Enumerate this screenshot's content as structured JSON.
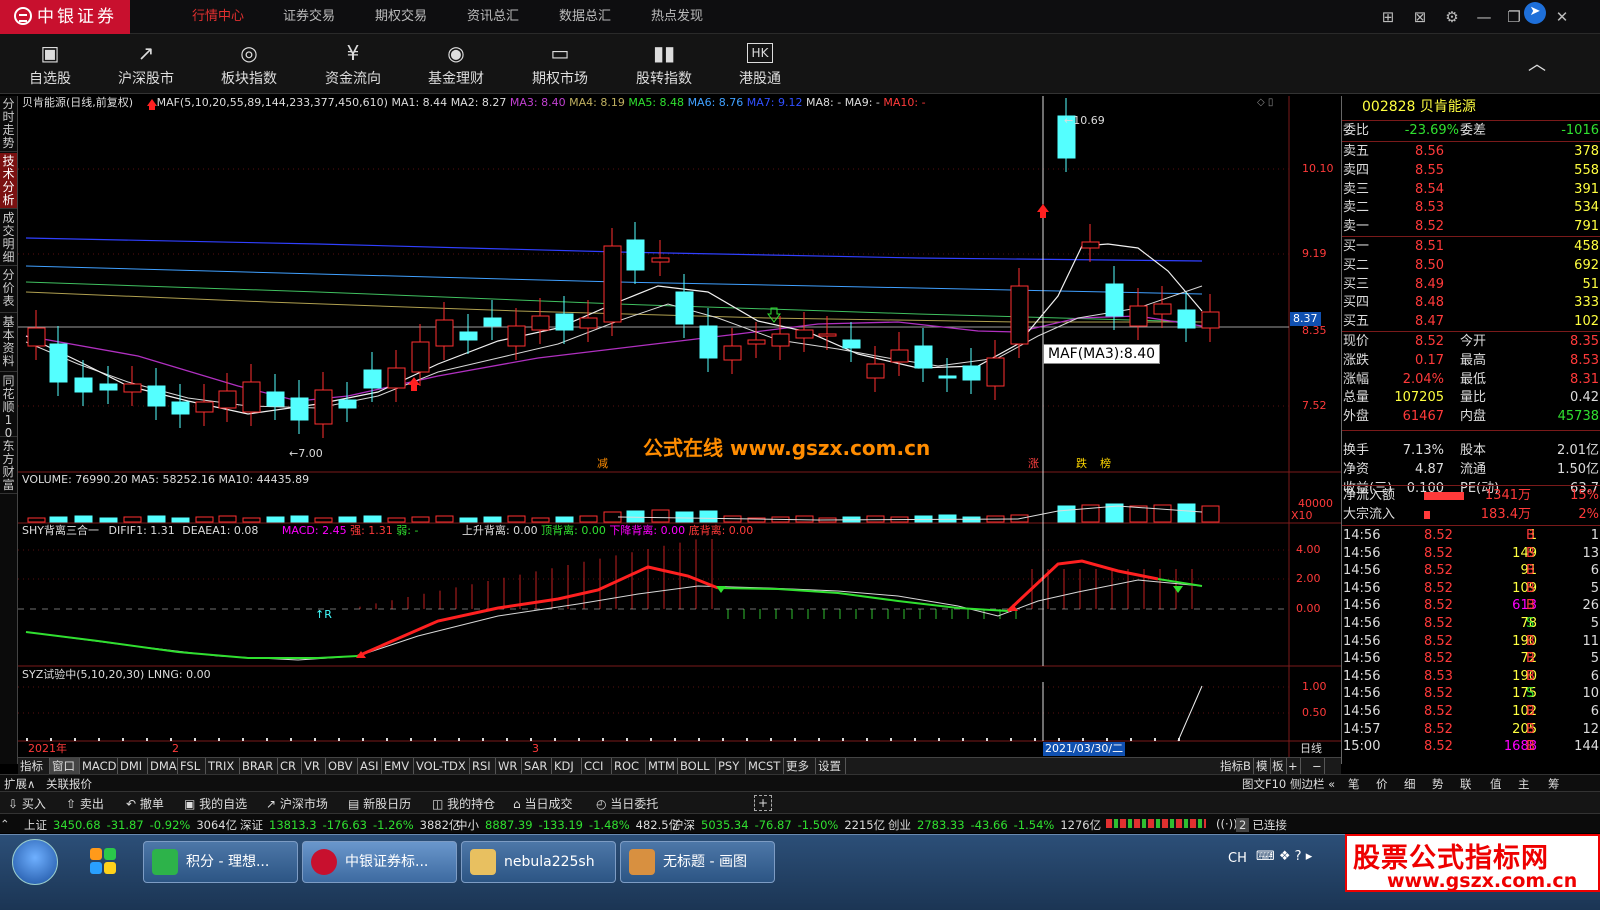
{
  "brand": "中银证券",
  "nav": {
    "menus": [
      "行情中心",
      "证券交易",
      "期权交易",
      "资讯总汇",
      "数据总汇",
      "热点发现"
    ]
  },
  "toolbar": [
    "自选股",
    "沪深股市",
    "板块指数",
    "资金流向",
    "基金理财",
    "期权市场",
    "股转指数",
    "港股通"
  ],
  "toolbar_icons": [
    "folder-heart-icon",
    "chart-trend-icon",
    "sector-icon",
    "money-flow-icon",
    "fund-icon",
    "option-icon",
    "bar-index-icon",
    "hk-icon"
  ],
  "leftbar": [
    "分时走势",
    "技术分析",
    "成交明细",
    "分价表",
    "基本资料",
    "同花顺10",
    "东方财富"
  ],
  "main_header": {
    "title": "贝肯能源(日线,前复权)",
    "maf": "MAF(5,10,20,55,89,144,233,377,450,610)",
    "ma1": "MA1: 8.44",
    "ma2": "MA2: 8.27",
    "ma3": "MA3: 8.40",
    "ma4": "MA4: 8.19",
    "ma5": "MA5: 8.48",
    "ma6": "MA6: 8.76",
    "ma7": "MA7: 9.12",
    "ma8": "MA8: -",
    "ma9": "MA9: -",
    "ma10": "MA10: -"
  },
  "price_axis": [
    "10.10",
    "9.19",
    "8.35",
    "7.52"
  ],
  "price_tag": "8.37",
  "hi_label": "10.69",
  "lo_label": "7.00",
  "tooltip": "MAF(MA3):8.40",
  "watermark": "公式在线 www.gszx.com.cn",
  "marks": {
    "jian": "减",
    "zhang": "涨",
    "die": "跌",
    "bei": "榜"
  },
  "volume_header": "VOLUME: 76990.20  MA5: 58252.16  MA10: 44435.89",
  "vol_axis": "40000",
  "vol_unit": "X10",
  "macd_header": {
    "name": "SHY背离三合一",
    "dif": "DIFIF1: 1.31",
    "dea": "DEAEA1: 0.08",
    "macd": "MACD: 2.45",
    "qiang": "强: 1.31",
    "ruo": "弱: -",
    "up": "上升背离: 0.00",
    "top": "顶背离: 0.00",
    "down": "下降背离: 0.00",
    "bottom": "底背离: 0.00"
  },
  "macd_axis": [
    "4.00",
    "2.00",
    "0.00"
  ],
  "macd_mark": "↑R",
  "syz_header": "SYZ试验中(5,10,20,30)  LNNG: 0.00",
  "syz_axis": [
    "1.00",
    "0.50"
  ],
  "dates": {
    "d0": "2021年",
    "d1": "2",
    "d2": "3",
    "cur": "2021/03/30/二",
    "period": "日线"
  },
  "index_tabs": [
    "指标A",
    "窗口",
    "MACD",
    "DMI",
    "DMA",
    "FSL",
    "TRIX",
    "BRAR",
    "CR",
    "VR",
    "OBV",
    "ASI",
    "EMV",
    "VOL-TDX",
    "RSI",
    "WR",
    "SAR",
    "KDJ",
    "CCI",
    "ROC",
    "MTM",
    "BOLL",
    "PSY",
    "MCST",
    "更多",
    "设置"
  ],
  "index_right": [
    "指标B",
    "模",
    "板",
    "+",
    "−"
  ],
  "status1": {
    "left1": "扩展∧",
    "left2": "关联报价",
    "right": [
      "图文F10",
      "侧边栏 «",
      "笔",
      "价",
      "细",
      "势",
      "联",
      "值",
      "主",
      "筹"
    ]
  },
  "actions": [
    "买入",
    "卖出",
    "撤单",
    "我的自选",
    "沪深市场",
    "新股日历",
    "我的持仓",
    "当日成交",
    "当日委托"
  ],
  "markets": [
    {
      "name": "上证",
      "val": "3450.68",
      "chg": "-31.87",
      "pct": "-0.92%",
      "amt": "3064亿"
    },
    {
      "name": "深证",
      "val": "13813.3",
      "chg": "-176.63",
      "pct": "-1.26%",
      "amt": "3882亿"
    },
    {
      "name": "中小",
      "val": "8887.39",
      "chg": "-133.19",
      "pct": "-1.48%",
      "amt": "482.5亿"
    },
    {
      "name": "沪深",
      "val": "5035.34",
      "chg": "-76.87",
      "pct": "-1.50%",
      "amt": "2215亿"
    },
    {
      "name": "创业",
      "val": "2783.33",
      "chg": "-43.66",
      "pct": "-1.54%",
      "amt": "1276亿"
    }
  ],
  "connect": "已连接",
  "connect_num": "2",
  "quote": {
    "code": "002828 贝肯能源",
    "weibi": {
      "l": "委比",
      "v": "-23.69%",
      "l2": "委差",
      "v2": "-1016"
    },
    "asks": [
      {
        "l": "卖五",
        "p": "8.56",
        "v": "378"
      },
      {
        "l": "卖四",
        "p": "8.55",
        "v": "558"
      },
      {
        "l": "卖三",
        "p": "8.54",
        "v": "391"
      },
      {
        "l": "卖二",
        "p": "8.53",
        "v": "534"
      },
      {
        "l": "卖一",
        "p": "8.52",
        "v": "791"
      }
    ],
    "bids": [
      {
        "l": "买一",
        "p": "8.51",
        "v": "458"
      },
      {
        "l": "买二",
        "p": "8.50",
        "v": "692"
      },
      {
        "l": "买三",
        "p": "8.49",
        "v": "51"
      },
      {
        "l": "买四",
        "p": "8.48",
        "v": "333"
      },
      {
        "l": "买五",
        "p": "8.47",
        "v": "102"
      }
    ],
    "stats": [
      {
        "l": "现价",
        "v": "8.52",
        "l2": "今开",
        "v2": "8.35"
      },
      {
        "l": "涨跌",
        "v": "0.17",
        "l2": "最高",
        "v2": "8.53"
      },
      {
        "l": "涨幅",
        "v": "2.04%",
        "l2": "最低",
        "v2": "8.31"
      },
      {
        "l": "总量",
        "v": "107205",
        "l2": "量比",
        "v2": "0.42"
      },
      {
        "l": "外盘",
        "v": "61467",
        "l2": "内盘",
        "v2": "45738"
      },
      {
        "l": "换手",
        "v": "7.13%",
        "l2": "股本",
        "v2": "2.01亿"
      },
      {
        "l": "净资",
        "v": "4.87",
        "l2": "流通",
        "v2": "1.50亿"
      },
      {
        "l": "收益(三)",
        "v": "0.100",
        "l2": "PE(动)",
        "v2": "63.7"
      }
    ],
    "flows": [
      {
        "l": "净流入额",
        "v": "1341万",
        "p": "15%"
      },
      {
        "l": "大宗流入",
        "v": "183.4万",
        "p": "2%"
      }
    ],
    "ticks": [
      {
        "t": "14:56",
        "p": "8.52",
        "v": "1",
        "d": "B",
        "n": "1"
      },
      {
        "t": "14:56",
        "p": "8.52",
        "v": "149",
        "d": "B",
        "n": "13"
      },
      {
        "t": "14:56",
        "p": "8.52",
        "v": "91",
        "d": "B",
        "n": "6"
      },
      {
        "t": "14:56",
        "p": "8.52",
        "v": "109",
        "d": "B",
        "n": "5"
      },
      {
        "t": "14:56",
        "p": "8.52",
        "v": "613",
        "d": "B",
        "n": "26"
      },
      {
        "t": "14:56",
        "p": "8.52",
        "v": "78",
        "d": "S",
        "n": "5"
      },
      {
        "t": "14:56",
        "p": "8.52",
        "v": "190",
        "d": "B",
        "n": "11"
      },
      {
        "t": "14:56",
        "p": "8.52",
        "v": "72",
        "d": "B",
        "n": "5"
      },
      {
        "t": "14:56",
        "p": "8.53",
        "v": "190",
        "d": "B",
        "n": "6"
      },
      {
        "t": "14:56",
        "p": "8.52",
        "v": "175",
        "d": "S",
        "n": "10"
      },
      {
        "t": "14:56",
        "p": "8.52",
        "v": "102",
        "d": "B",
        "n": "6"
      },
      {
        "t": "14:57",
        "p": "8.52",
        "v": "205",
        "d": "B",
        "n": "12"
      },
      {
        "t": "15:00",
        "p": "8.52",
        "v": "1688",
        "d": "B",
        "n": "144"
      }
    ]
  },
  "taskbar": [
    "积分 - 理想...",
    "中银证券标...",
    "nebula225sh",
    "无标题 - 画图"
  ],
  "tray": {
    "ime": "CH"
  },
  "ad": {
    "line1": "股票公式指标网",
    "line2": "www.gszx.com.cn"
  },
  "colors": {
    "up": "#ff3a3a",
    "down": "#30e030",
    "cyan": "#44ffff",
    "bg": "#000000",
    "grid_red": "#7a1a1a"
  }
}
